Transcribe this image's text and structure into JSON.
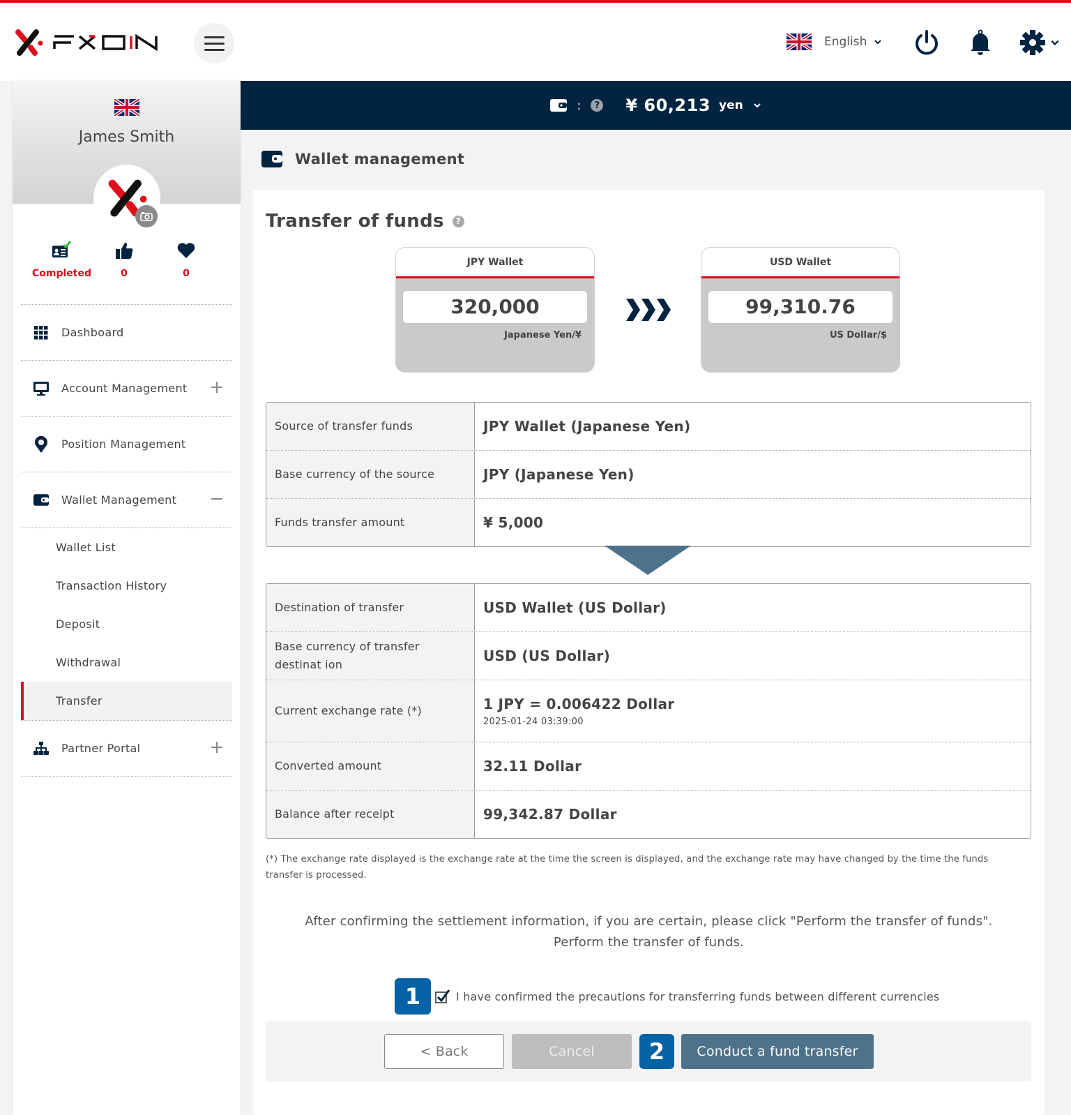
{
  "header": {
    "brand": "FXON",
    "language": "English",
    "icons": [
      "menu-icon",
      "uk-flag-icon",
      "power-icon",
      "bell-icon",
      "gear-icon"
    ]
  },
  "balance_bar": {
    "wallet_icon": "wallet-icon",
    "separator": ":",
    "help_icon": "question-icon",
    "amount": "¥ 60,213",
    "unit": "yen"
  },
  "sidebar": {
    "user_name": "James Smith",
    "stats": [
      {
        "icon": "id-card-check-icon",
        "value": "Completed"
      },
      {
        "icon": "thumbs-up-icon",
        "value": "0"
      },
      {
        "icon": "heart-icon",
        "value": "0"
      }
    ],
    "nav": [
      {
        "label": "Dashboard",
        "icon": "grid-icon"
      },
      {
        "label": "Account Management",
        "icon": "monitor-icon",
        "toggle": "+"
      },
      {
        "label": "Position Management",
        "icon": "map-pin-icon"
      },
      {
        "label": "Wallet Management",
        "icon": "wallet-icon",
        "toggle": "−"
      },
      {
        "label": "Partner Portal",
        "icon": "sitemap-icon",
        "toggle": "+"
      }
    ],
    "wallet_sub": [
      {
        "label": "Wallet List"
      },
      {
        "label": "Transaction History"
      },
      {
        "label": "Deposit"
      },
      {
        "label": "Withdrawal"
      },
      {
        "label": "Transfer",
        "active": true
      }
    ]
  },
  "page": {
    "section_title": "Wallet management",
    "card_title": "Transfer of funds",
    "help_icon": "question-icon"
  },
  "wallets": {
    "source": {
      "name": "JPY Wallet",
      "balance": "320,000",
      "currency": "Japanese Yen/¥"
    },
    "destination": {
      "name": "USD Wallet",
      "balance": "99,310.76",
      "currency": "US Dollar/$"
    }
  },
  "source_table": [
    {
      "label": "Source of transfer funds",
      "value": "JPY Wallet (Japanese Yen)"
    },
    {
      "label": "Base currency of the source",
      "value": "JPY (Japanese Yen)"
    },
    {
      "label": "Funds transfer amount",
      "value": "¥ 5,000"
    }
  ],
  "destination_table": [
    {
      "label": "Destination of transfer",
      "value": "USD Wallet (US Dollar)"
    },
    {
      "label": "Base currency of transfer destinat ion",
      "value": "USD (US Dollar)"
    },
    {
      "label": "Current exchange rate (*)",
      "value": "1 JPY = 0.006422 Dollar",
      "timestamp": "2025-01-24 03:39:00"
    },
    {
      "label": "Converted amount",
      "value": "32.11 Dollar"
    },
    {
      "label": "Balance after receipt",
      "value": "99,342.87 Dollar"
    }
  ],
  "footnote": "(*)   The exchange rate displayed is the exchange rate at the time the screen is displayed, and the exchange rate may have changed by the time the funds transfer is processed.",
  "confirm": {
    "line1": "After confirming the settlement information, if you are certain, please click \"Perform the transfer of funds\".",
    "line2": "Perform the transfer of funds.",
    "checkbox_label": "I have confirmed the precautions for transferring funds between different currencies",
    "checked": true
  },
  "steps": {
    "one": "1",
    "two": "2"
  },
  "buttons": {
    "back": "< Back",
    "cancel": "Cancel",
    "submit": "Conduct a fund transfer"
  },
  "colors": {
    "brand_red": "#e00f1c",
    "navy": "#022440",
    "step_blue": "#0562a6",
    "submit_blue": "#4d7289"
  }
}
